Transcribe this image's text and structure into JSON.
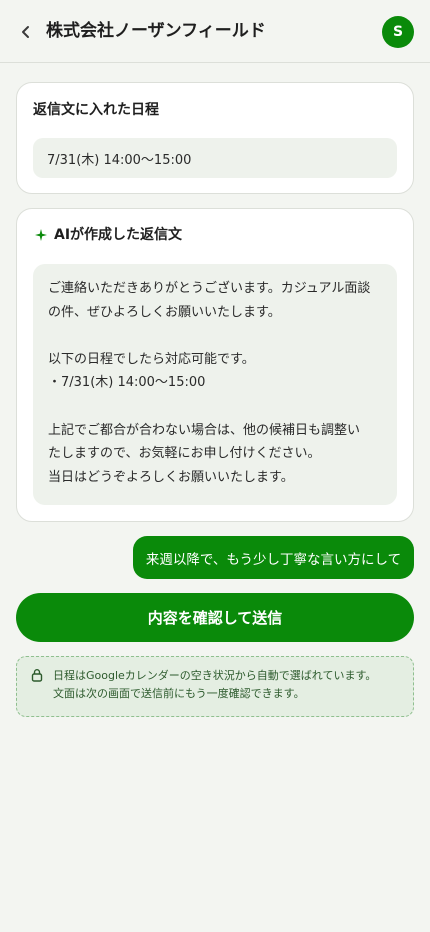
{
  "header": {
    "title": "株式会社ノーザンフィールド",
    "avatar_initial": "S",
    "back_icon": "chevron-left-icon"
  },
  "schedule_card": {
    "title": "返信文に入れた日程",
    "slot": "7/31(木) 14:00〜15:00"
  },
  "ai_card": {
    "title": "AIが作成した返信文",
    "icon": "sparkle-icon",
    "body": {
      "line1": "ご連絡いただきありがとうございます。カジュアル面談",
      "line2": "の件、ぜひよろしくお願いいたします。",
      "line3": "以下の日程でしたら対応可能です。",
      "line4": "・7/31(木) 14:00〜15:00",
      "line5": "上記でご都合が合わない場合は、他の候補日も調整い",
      "line6": "たしますので、お気軽にお申し付けください。",
      "line7": "当日はどうぞよろしくお願いいたします。"
    }
  },
  "chat": {
    "user_message": "来週以降で、もう少し丁寧な言い方にして"
  },
  "actions": {
    "confirm_send_label": "内容を確認して送信"
  },
  "notice": {
    "icon": "lock-icon",
    "line1": "日程はGoogleカレンダーの空き状況から自動で選ばれています。",
    "line2": "文面は次の画面で送信前にもう一度確認できます。"
  },
  "colors": {
    "brand": "#0a8a0a",
    "background": "#f3f5f1",
    "card": "#ffffff",
    "soft_box": "#eef2ec",
    "notice_bg": "#e4eee2"
  }
}
